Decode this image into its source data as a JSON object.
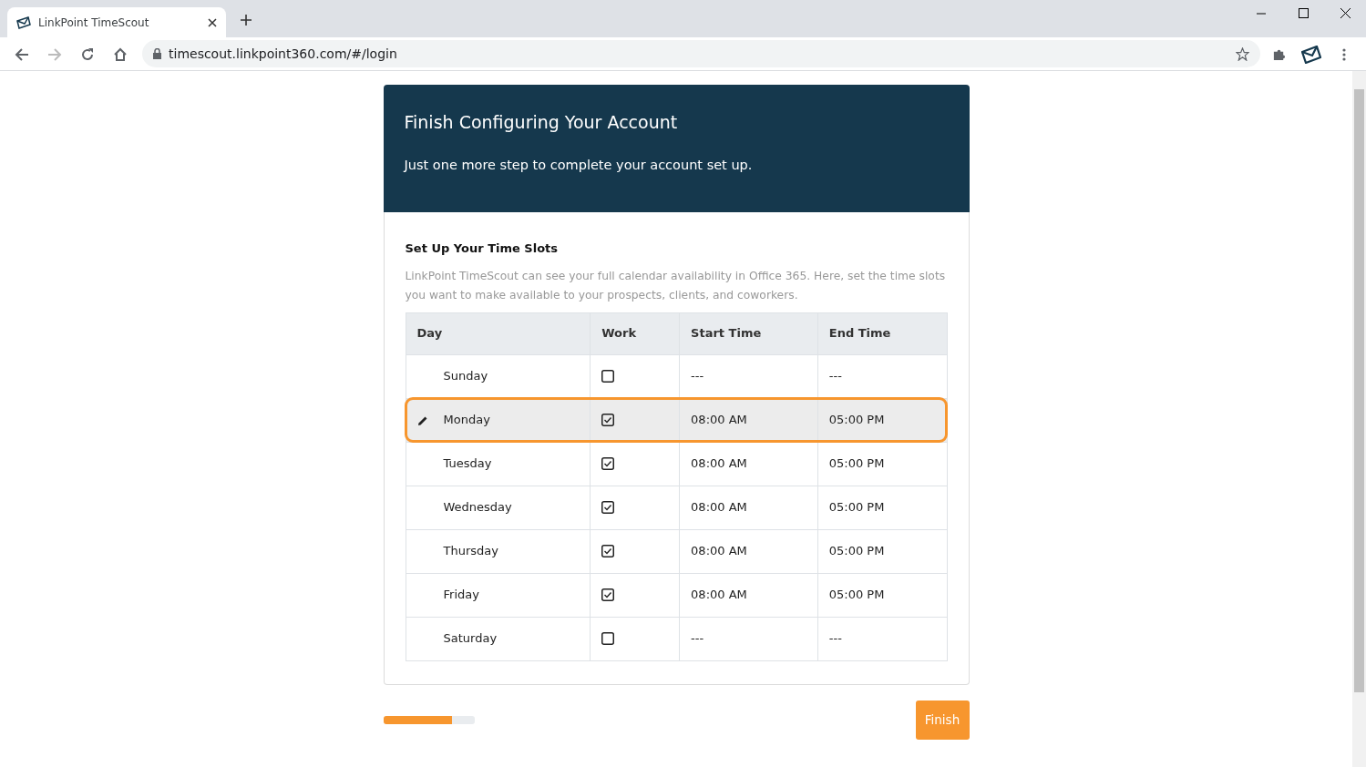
{
  "browser": {
    "tab_title": "LinkPoint TimeScout",
    "url": "timescout.linkpoint360.com/#/login"
  },
  "header": {
    "title": "Finish Configuring Your Account",
    "subtitle": "Just one more step to complete your account set up."
  },
  "section": {
    "title": "Set Up Your Time Slots",
    "description": "LinkPoint TimeScout can see your full calendar availability in Office 365. Here, set the time slots you want to make available to your prospects, clients, and coworkers."
  },
  "table": {
    "columns": [
      "Day",
      "Work",
      "Start Time",
      "End Time"
    ],
    "rows": [
      {
        "day": "Sunday",
        "work": false,
        "start": "---",
        "end": "---",
        "selected": false
      },
      {
        "day": "Monday",
        "work": true,
        "start": "08:00 AM",
        "end": "05:00 PM",
        "selected": true
      },
      {
        "day": "Tuesday",
        "work": true,
        "start": "08:00 AM",
        "end": "05:00 PM",
        "selected": false
      },
      {
        "day": "Wednesday",
        "work": true,
        "start": "08:00 AM",
        "end": "05:00 PM",
        "selected": false
      },
      {
        "day": "Thursday",
        "work": true,
        "start": "08:00 AM",
        "end": "05:00 PM",
        "selected": false
      },
      {
        "day": "Friday",
        "work": true,
        "start": "08:00 AM",
        "end": "05:00 PM",
        "selected": false
      },
      {
        "day": "Saturday",
        "work": false,
        "start": "---",
        "end": "---",
        "selected": false
      }
    ]
  },
  "progress": {
    "level": 0.75
  },
  "finish_button": "Finish"
}
